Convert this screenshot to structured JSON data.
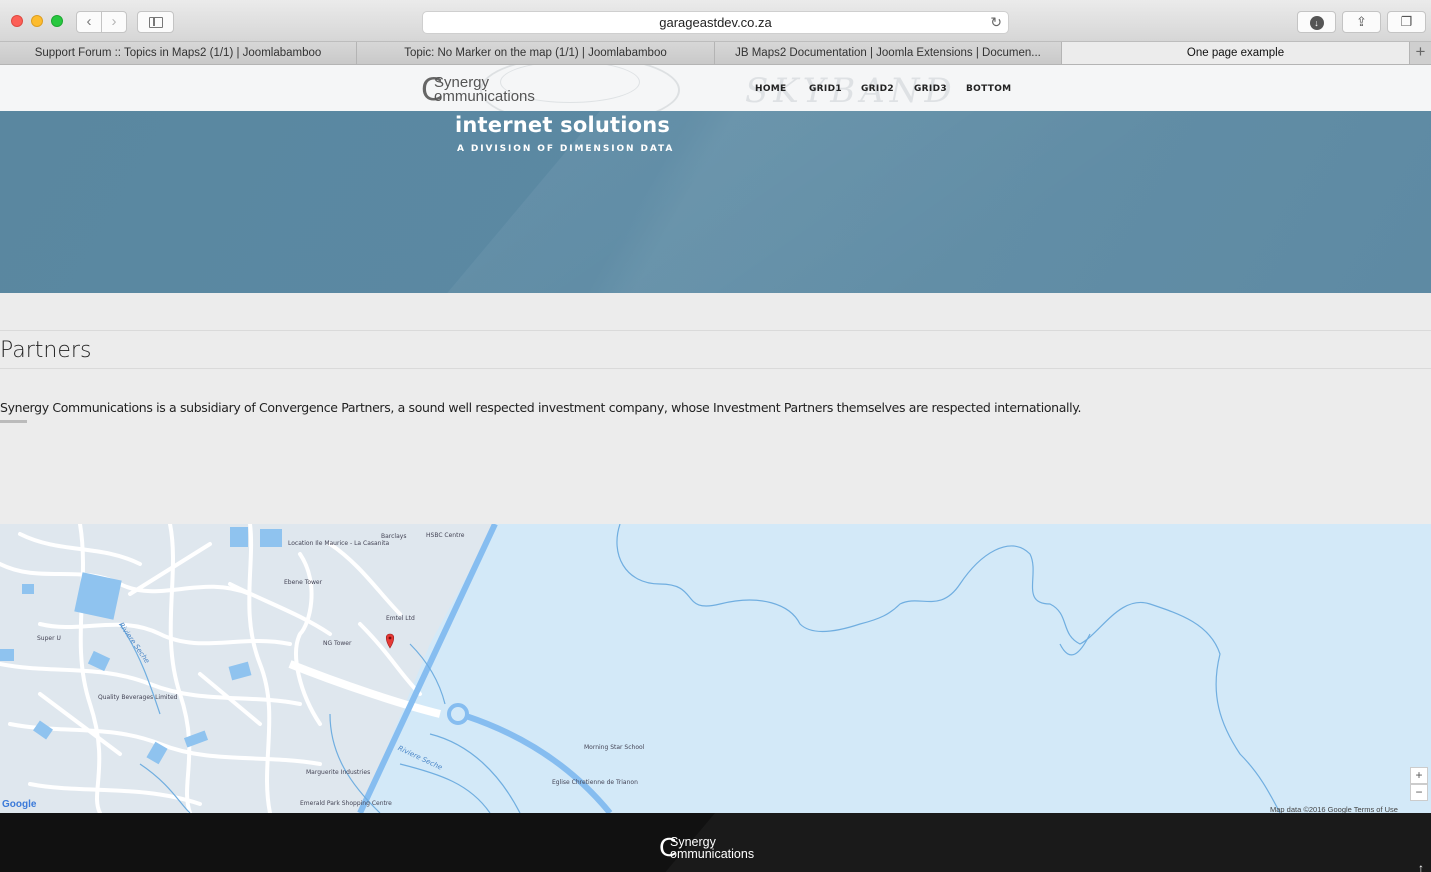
{
  "browser": {
    "url": "garageastdev.co.za",
    "tabs": [
      {
        "label": "Support Forum :: Topics in Maps2 (1/1) | Joomlabamboo",
        "active": false
      },
      {
        "label": "Topic: No Marker on the map (1/1) | Joomlabamboo",
        "active": false
      },
      {
        "label": "JB Maps2 Documentation | Joomla Extensions | Documen...",
        "active": false
      },
      {
        "label": "One page example",
        "active": true
      }
    ],
    "icons": {
      "back": "chevron-left-icon",
      "forward": "chevron-right-icon",
      "sidebar": "sidebar-icon",
      "reload": "reload-icon",
      "download": "download-icon",
      "share": "share-icon",
      "tabs": "tabs-overview-icon",
      "new_tab": "plus-icon"
    }
  },
  "header": {
    "logo_c": "C",
    "logo_line1": "Synergy",
    "logo_line2": "ommunications",
    "watermark": "SKYBAND",
    "nav": [
      {
        "label": "HOME"
      },
      {
        "label": "GRID1"
      },
      {
        "label": "GRID2"
      },
      {
        "label": "GRID3"
      },
      {
        "label": "BOTTOM"
      }
    ]
  },
  "hero": {
    "title": "internet solutions",
    "subtitle": "A DIVISION OF DIMENSION DATA"
  },
  "partners": {
    "title": "Partners",
    "text": "Synergy Communications is a subsidiary of Convergence Partners, a sound well respected investment company, whose Investment Partners themselves are respected internationally."
  },
  "map": {
    "pois": [
      "Location Ile Maurice - La Casanita",
      "Barclays",
      "HSBC Centre",
      "Ebene Tower",
      "Emtel Ltd",
      "NG Tower",
      "Super U",
      "Quality Beverages Limited",
      "Morning Star School",
      "Marguerite Industries",
      "Eglise Chretienne de Trianon",
      "Emerald Park Shopping Centre"
    ],
    "rivers": [
      "Riviere Seche",
      "Riviere Seche"
    ],
    "zoom_in": "+",
    "zoom_out": "−",
    "brand": "Google",
    "attribution": "Map data ©2016 Google   Terms of Use",
    "marker_icon": "map-marker-icon"
  },
  "footer": {
    "logo_c": "C",
    "logo_line1": "Synergy",
    "logo_line2": "ommunications",
    "to_top": "↑"
  }
}
